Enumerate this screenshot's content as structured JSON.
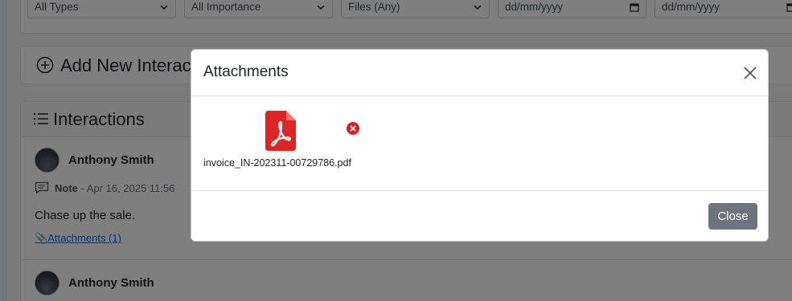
{
  "filters": {
    "type": "All Types",
    "importance": "All Importance",
    "files": "Files (Any)",
    "date_from_placeholder": "dd/mm/yyyy",
    "date_to_placeholder": "dd/mm/yyyy"
  },
  "add_panel": {
    "title": "Add New Interaction"
  },
  "interactions": {
    "title": "Interactions",
    "items": [
      {
        "author": "Anthony Smith",
        "type": "Note",
        "date": "Apr 16, 2025 11:56",
        "body": "Chase up the sale.",
        "attachments_label": "Attachments (1)"
      },
      {
        "author": "Anthony Smith"
      }
    ]
  },
  "modal": {
    "title": "Attachments",
    "files": [
      {
        "name": "invoice_IN-202311-00729786.pdf",
        "icon": "pdf-file-icon"
      }
    ],
    "close_label": "Close"
  },
  "colors": {
    "accent": "#0d6efd",
    "pdf_red": "#dc2626",
    "remove_red": "#e11d1d",
    "close_button": "#6c757d"
  }
}
